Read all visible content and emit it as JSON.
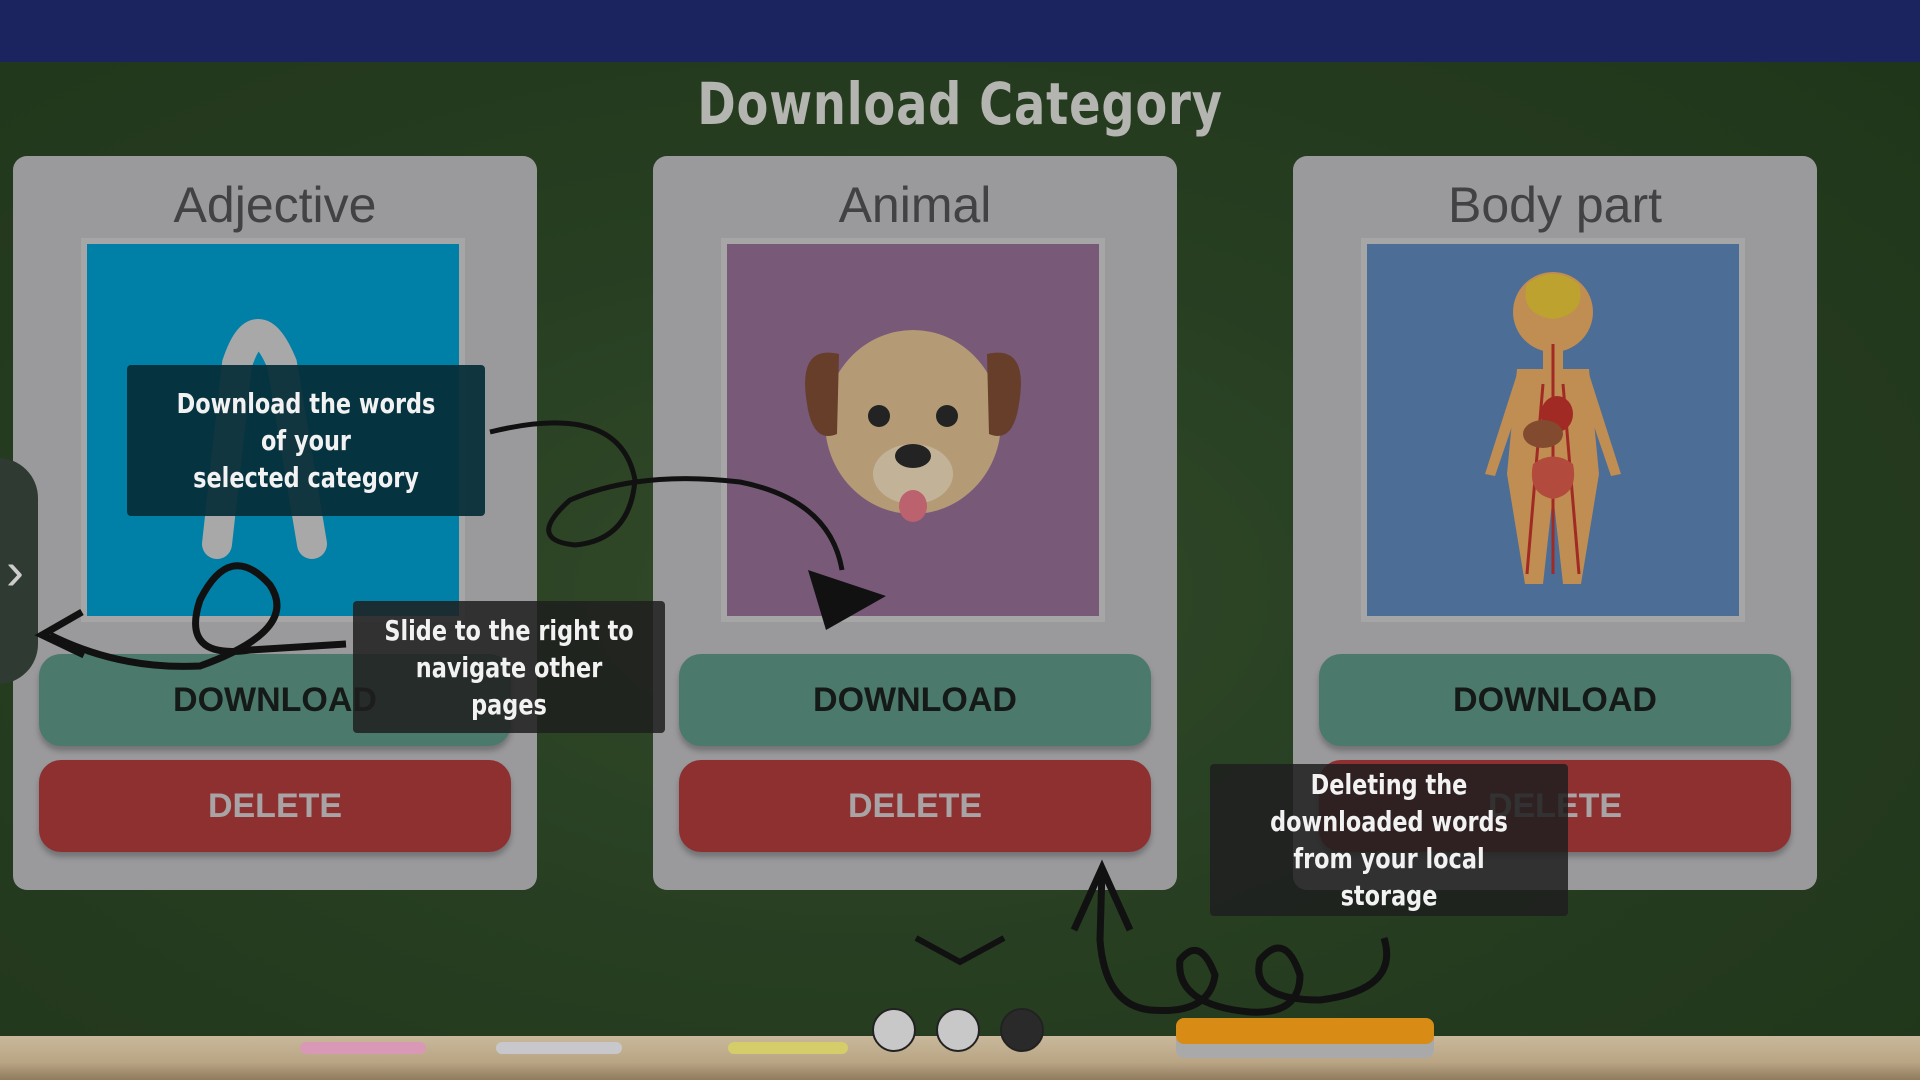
{
  "page": {
    "title": "Download Category"
  },
  "cards": [
    {
      "title": "Adjective",
      "image_icon": "letter-a-icon",
      "download_label": "DOWNLOAD",
      "delete_label": "DELETE"
    },
    {
      "title": "Animal",
      "image_icon": "dog-face-icon",
      "download_label": "DOWNLOAD",
      "delete_label": "DELETE"
    },
    {
      "title": "Body part",
      "image_icon": "human-anatomy-icon",
      "download_label": "DOWNLOAD",
      "delete_label": "DELETE"
    }
  ],
  "tooltips": {
    "download": "Download the words of your\nselected category",
    "slide": "Slide to the right to\nnavigate other pages",
    "delete": "Deleting the downloaded words\nfrom your local storage"
  },
  "pagination": {
    "total": 3,
    "current": 3
  },
  "colors": {
    "topbar": "#222c73",
    "download": "#5a9281",
    "delete": "#ab3a3a",
    "card": "#b8b8bb",
    "adjective_bg": "#0098c8",
    "animal_bg": "#8f6a90",
    "bodypart_bg": "#5b82b2"
  }
}
